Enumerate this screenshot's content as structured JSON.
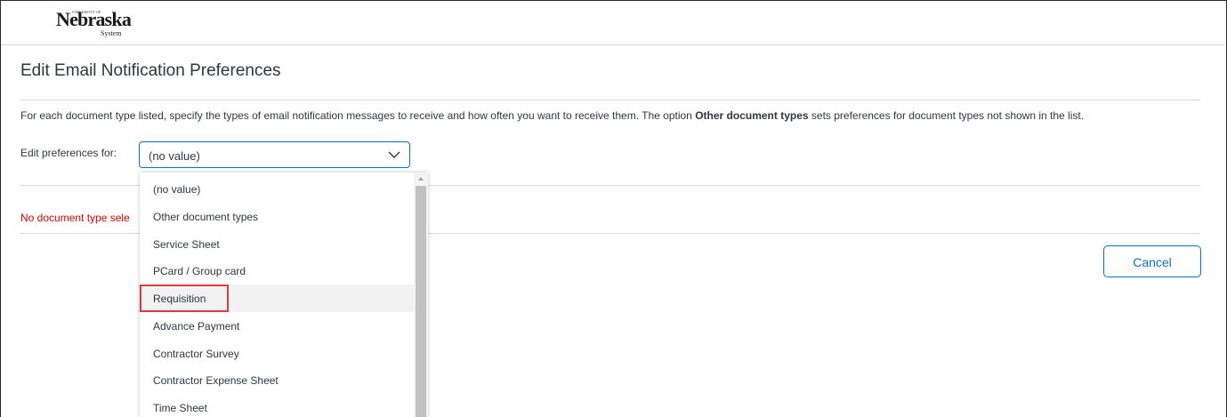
{
  "logo": {
    "small_text": "UNIVERSITY OF",
    "name": "Nebraska",
    "sub": "System"
  },
  "page": {
    "title": "Edit Email Notification Preferences",
    "description_pre": "For each document type listed, specify the types of email notification messages to receive and how often you want to receive them. The option ",
    "description_bold": "Other document types",
    "description_post": " sets preferences for document types not shown in the list.",
    "pref_label": "Edit preferences for:",
    "error_text": "No document type sele"
  },
  "select": {
    "value": "(no value)",
    "icon": "chevron-down-icon"
  },
  "dropdown": {
    "options": [
      "(no value)",
      "Other document types",
      "Service Sheet",
      "PCard / Group card",
      "Requisition",
      "Advance Payment",
      "Contractor Survey",
      "Contractor Expense Sheet",
      "Time Sheet"
    ],
    "highlighted": "Requisition"
  },
  "buttons": {
    "cancel": "Cancel"
  },
  "colors": {
    "accent": "#0a6ed1",
    "error": "#e00000",
    "highlight_border": "#e0393e"
  }
}
